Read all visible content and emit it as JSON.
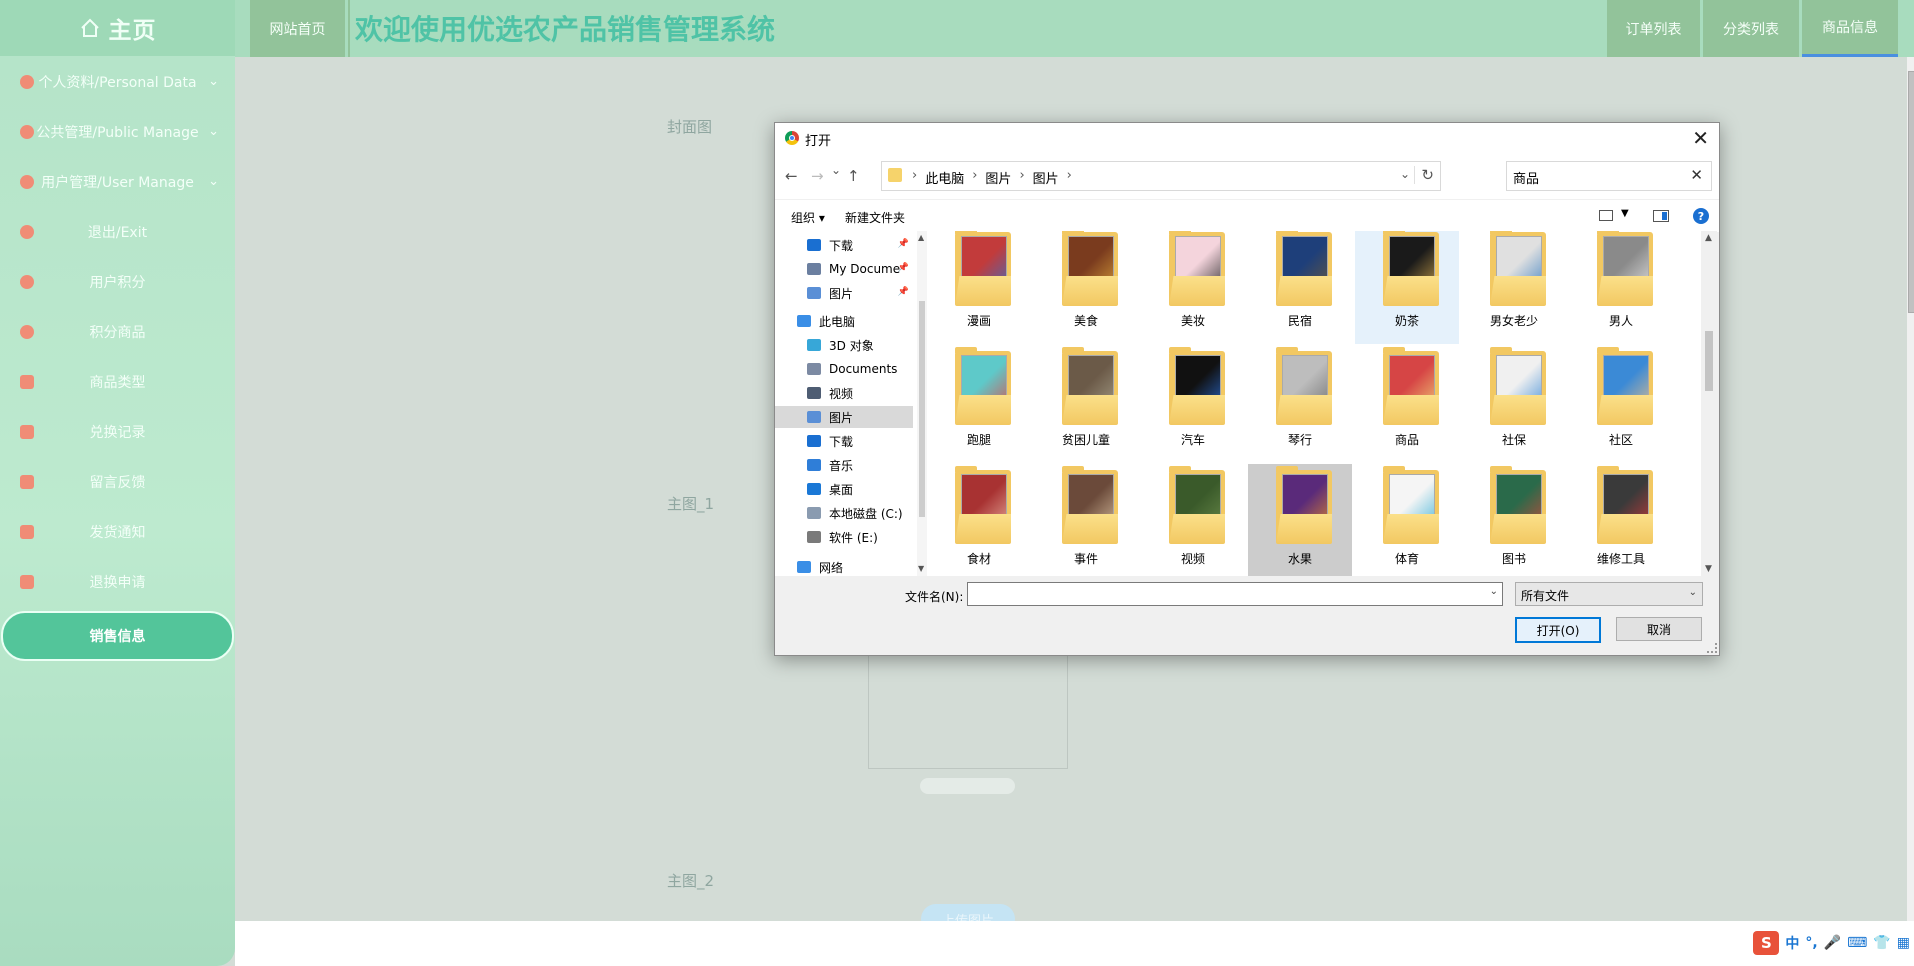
{
  "sidebar": {
    "logo": "主页",
    "items": [
      {
        "label": "个人资料/Personal Data",
        "icon": "flag-icon",
        "has_chevron": true
      },
      {
        "label": "公共管理/Public Manage",
        "icon": "building-icon",
        "has_chevron": true
      },
      {
        "label": "用户管理/User Manage",
        "icon": "user-icon",
        "has_chevron": true
      },
      {
        "label": "退出/Exit",
        "icon": "exit-icon",
        "has_chevron": false
      },
      {
        "label": "用户积分",
        "icon": "points-icon",
        "has_chevron": false
      },
      {
        "label": "积分商品",
        "icon": "gift-icon",
        "has_chevron": false
      },
      {
        "label": "商品类型",
        "icon": "category-icon",
        "has_chevron": false
      },
      {
        "label": "兑换记录",
        "icon": "record-icon",
        "has_chevron": false
      },
      {
        "label": "留言反馈",
        "icon": "message-icon",
        "has_chevron": false
      },
      {
        "label": "发货通知",
        "icon": "notice-icon",
        "has_chevron": false
      },
      {
        "label": "退换申请",
        "icon": "return-icon",
        "has_chevron": false
      },
      {
        "label": "销售信息",
        "icon": "sales-icon",
        "has_chevron": false,
        "active": true
      }
    ]
  },
  "header": {
    "home_tab": "网站首页",
    "title": "欢迎使用优选农产品销售管理系统",
    "right_tabs": [
      "订单列表",
      "分类列表",
      "商品信息"
    ],
    "active_tab": "商品信息"
  },
  "form": {
    "cover_label": "封面图",
    "main1_label": "主图_1",
    "main2_label": "主图_2",
    "upload_button": "上传图片"
  },
  "dialog": {
    "title": "打开",
    "close": "✕",
    "nav": {
      "back": "←",
      "forward": "→",
      "recent": "⌄",
      "up": "↑"
    },
    "breadcrumb": [
      "此电脑",
      "图片",
      "图片"
    ],
    "refresh": "↻",
    "search_value": "商品",
    "search_clear": "✕",
    "toolbar": {
      "organize": "组织 ▾",
      "new_folder": "新建文件夹",
      "help": "?"
    },
    "tree": [
      {
        "label": "下载",
        "icon_color": "#1a6fd1",
        "pinned": true,
        "indent": 1
      },
      {
        "label": "My Docume",
        "icon_color": "#6b7fa0",
        "pinned": true,
        "indent": 1
      },
      {
        "label": "图片",
        "icon_color": "#5a8fd6",
        "pinned": true,
        "indent": 1
      },
      {
        "label": "此电脑",
        "icon_color": "#3a8ee6",
        "pinned": false,
        "indent": 0
      },
      {
        "label": "3D 对象",
        "icon_color": "#37a7d8",
        "pinned": false,
        "indent": 1
      },
      {
        "label": "Documents",
        "icon_color": "#7c8aa3",
        "pinned": false,
        "indent": 1
      },
      {
        "label": "视频",
        "icon_color": "#4e5d73",
        "pinned": false,
        "indent": 1
      },
      {
        "label": "图片",
        "icon_color": "#5a8fd6",
        "pinned": false,
        "indent": 1,
        "selected": true
      },
      {
        "label": "下载",
        "icon_color": "#1a6fd1",
        "pinned": false,
        "indent": 1
      },
      {
        "label": "音乐",
        "icon_color": "#2f7ed8",
        "pinned": false,
        "indent": 1
      },
      {
        "label": "桌面",
        "icon_color": "#1a78d6",
        "pinned": false,
        "indent": 1
      },
      {
        "label": "本地磁盘 (C:)",
        "icon_color": "#8a9bb0",
        "pinned": false,
        "indent": 1
      },
      {
        "label": "软件 (E:)",
        "icon_color": "#7a7a7a",
        "pinned": false,
        "indent": 1
      },
      {
        "label": "网络",
        "icon_color": "#3a8ee6",
        "pinned": false,
        "indent": 0
      }
    ],
    "files": [
      {
        "name": "漫画",
        "c1": "#c23b3b",
        "c2": "#3b6fc2"
      },
      {
        "name": "美食",
        "c1": "#7a3b1e",
        "c2": "#d9a13b"
      },
      {
        "name": "美妆",
        "c1": "#f4d4dc",
        "c2": "#2a2a2a"
      },
      {
        "name": "民宿",
        "c1": "#1e3f7a",
        "c2": "#6b5a3b"
      },
      {
        "name": "奶茶",
        "c1": "#1a1a1a",
        "c2": "#c9a04a",
        "hover": true
      },
      {
        "name": "男女老少",
        "c1": "#e0e0e0",
        "c2": "#3a7fc2"
      },
      {
        "name": "男人",
        "c1": "#8a8a8a",
        "c2": "#e5e5e5"
      },
      {
        "name": "跑腿",
        "c1": "#5ec9c9",
        "c2": "#e04a4a"
      },
      {
        "name": "贫困儿童",
        "c1": "#6b5a48",
        "c2": "#a8a08a"
      },
      {
        "name": "汽车",
        "c1": "#111111",
        "c2": "#2a6bd1"
      },
      {
        "name": "琴行",
        "c1": "#bdbdbd",
        "c2": "#6e6e6e"
      },
      {
        "name": "商品",
        "c1": "#d64545",
        "c2": "#f0d27a"
      },
      {
        "name": "社保",
        "c1": "#f0f0f0",
        "c2": "#3b8ad6"
      },
      {
        "name": "社区",
        "c1": "#3b8ad6",
        "c2": "#e8c08a"
      },
      {
        "name": "食材",
        "c1": "#a83232",
        "c2": "#e8b0a0"
      },
      {
        "name": "事件",
        "c1": "#6b4a3a",
        "c2": "#d9c0a0"
      },
      {
        "name": "视频",
        "c1": "#3a5a2a",
        "c2": "#6a8a4a"
      },
      {
        "name": "水果",
        "c1": "#5a2a7a",
        "c2": "#e08a2a",
        "selected": true
      },
      {
        "name": "体育",
        "c1": "#f5f5f5",
        "c2": "#3ab0d6"
      },
      {
        "name": "图书",
        "c1": "#2a6a4a",
        "c2": "#c94a3a"
      },
      {
        "name": "维修工具",
        "c1": "#3a3a3a",
        "c2": "#c93a3a"
      }
    ],
    "filename_label": "文件名(N):",
    "filename_value": "",
    "filetype_value": "所有文件",
    "open_button": "打开(O)",
    "cancel_button": "取消"
  },
  "ime": {
    "logo": "S",
    "lang": "中",
    "punct": "°,",
    "extras": [
      "🎤",
      "⌨",
      "👕",
      "▦"
    ]
  },
  "colors": {
    "sidebar": "#b4e3c8",
    "title": "#4fc3a6",
    "active_menu": "#53c59a",
    "tab": "#92c39a"
  }
}
